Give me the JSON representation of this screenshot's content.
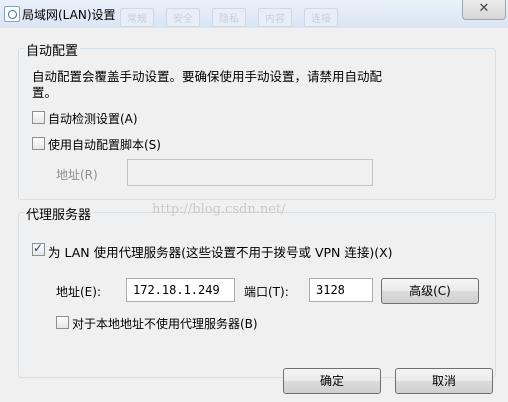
{
  "window": {
    "title": "局域网(LAN)设置",
    "close_glyph": "✕",
    "ghost_tabs": [
      "常规",
      "安全",
      "隐私",
      "内容",
      "连接"
    ]
  },
  "auto_config": {
    "group_title": "自动配置",
    "description_line1": "自动配置会覆盖手动设置。要确保使用手动设置，请禁用自动配",
    "description_line2": "置。",
    "auto_detect_label": "自动检测设置(A)",
    "auto_detect_checked": false,
    "use_script_label": "使用自动配置脚本(S)",
    "use_script_checked": false,
    "address_label": "地址(R)",
    "address_value": ""
  },
  "proxy": {
    "group_title": "代理服务器",
    "use_proxy_label": "为 LAN 使用代理服务器(这些设置不用于拨号或 VPN 连接)(X)",
    "use_proxy_checked": true,
    "address_label": "地址(E):",
    "address_value": "172.18.1.249",
    "port_label": "端口(T):",
    "port_value": "3128",
    "advanced_button": "高级(C)",
    "bypass_local_label": "对于本地地址不使用代理服务器(B)",
    "bypass_local_checked": false
  },
  "footer": {
    "ok_button": "确定",
    "cancel_button": "取消"
  },
  "watermark": "http://blog.csdn.net/"
}
